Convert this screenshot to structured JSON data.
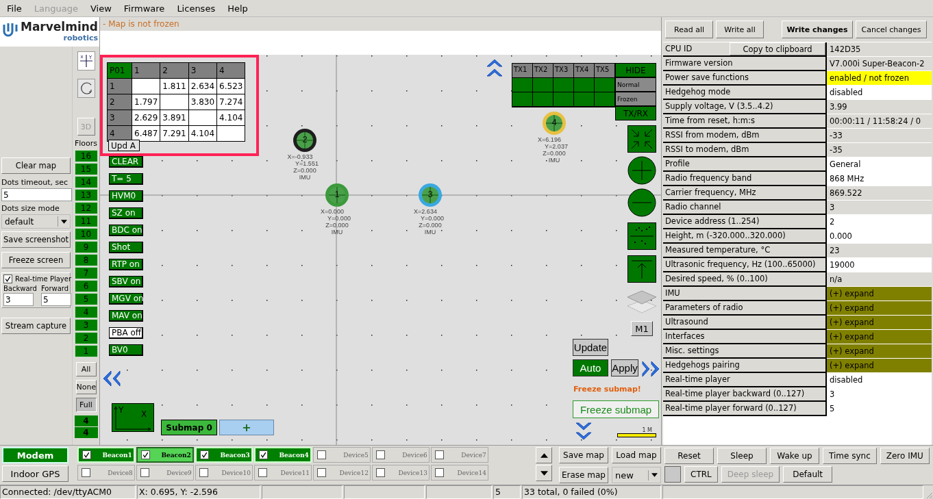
{
  "menu": [
    {
      "label": "File",
      "disabled": false
    },
    {
      "label": "Language",
      "disabled": true
    },
    {
      "label": "View",
      "disabled": false
    },
    {
      "label": "Firmware",
      "disabled": false
    },
    {
      "label": "Licenses",
      "disabled": false
    },
    {
      "label": "Help",
      "disabled": false
    }
  ],
  "logo": {
    "name": "Marvelmind",
    "tagline": "robotics"
  },
  "left_panel": {
    "clear_map": "Clear map",
    "dots_timeout": {
      "label": "Dots timeout, sec",
      "value": "5"
    },
    "dots_size": {
      "label": "Dots size mode",
      "value": "default"
    },
    "save_screenshot": "Save screenshot",
    "freeze_screen": "Freeze screen",
    "realtime_player": {
      "label": "Real-time Player",
      "checked": true
    },
    "backward": {
      "label": "Backward",
      "value": "3"
    },
    "forward": {
      "label": "Forward",
      "value": "5"
    },
    "stream_capture": "Stream capture"
  },
  "floors": {
    "view_3d": {
      "label": "3D",
      "disabled": true
    },
    "title": "Floors",
    "levels": [
      "16",
      "15",
      "14",
      "13",
      "12",
      "11",
      "10",
      "9",
      "8",
      "7",
      "6",
      "5",
      "4",
      "3",
      "2",
      "1"
    ],
    "filters": [
      {
        "label": "All",
        "selected": false
      },
      {
        "label": "None",
        "selected": false
      },
      {
        "label": "Full",
        "selected": true
      }
    ],
    "counters": [
      "4",
      "4"
    ]
  },
  "map": {
    "status": "- Map is not frozen",
    "distance_table": {
      "corner": "P01",
      "columns": [
        "1",
        "2",
        "3",
        "4"
      ],
      "rows": [
        {
          "label": "1",
          "cells": [
            null,
            "1.811",
            "2.634",
            "6.523"
          ]
        },
        {
          "label": "2",
          "cells": [
            "1.797",
            null,
            "3.830",
            "7.274"
          ]
        },
        {
          "label": "3",
          "cells": [
            "2.629",
            "3.891",
            null,
            "4.104"
          ]
        },
        {
          "label": "4",
          "cells": [
            "6.487",
            "7.291",
            "4.104",
            null
          ]
        }
      ]
    },
    "update_button": "Upd A",
    "toggles": [
      {
        "label": "CLEAR",
        "on": true
      },
      {
        "label": "T= 5",
        "on": true
      },
      {
        "label": "HVM0",
        "on": true
      },
      {
        "label": "SZ on",
        "on": true
      },
      {
        "label": "BDC on",
        "on": true
      },
      {
        "label": "Shot",
        "on": true
      },
      {
        "label": "RTP on",
        "on": true
      },
      {
        "label": "SBV on",
        "on": true
      },
      {
        "label": "MGV on",
        "on": true
      },
      {
        "label": "MAV on",
        "on": true
      },
      {
        "label": "PBA off",
        "on": false
      },
      {
        "label": "BV0",
        "on": true
      }
    ],
    "beacons": [
      {
        "number": "1",
        "color": "#3c9a3c",
        "lines": [
          "X=0.000",
          "Y=0.000",
          "Z=0.000",
          "IMU"
        ]
      },
      {
        "number": "2",
        "color": "#1e1e1e",
        "lines": [
          "X=-0.933",
          "Y=1.551",
          "Z=0.000",
          "IMU"
        ]
      },
      {
        "number": "3",
        "color": "#3aa8e0",
        "lines": [
          "X=2.634",
          "Y=0.000",
          "Z=0.000",
          "IMU"
        ]
      },
      {
        "number": "4",
        "color": "#e8c040",
        "lines": [
          "X=6.196",
          "Y=2.037",
          "Z=0.000",
          "IMU"
        ]
      }
    ],
    "tx_panel": {
      "headers": [
        "TX1",
        "TX2",
        "TX3",
        "TX4",
        "TX5"
      ],
      "buttons": [
        {
          "label": "HIDE",
          "on": true
        },
        {
          "label": "Normal",
          "on": false
        },
        {
          "label": "Frozen",
          "on": false
        },
        {
          "label": "TX/RX",
          "on": true
        }
      ]
    },
    "floor_button": "M1",
    "update": "Update",
    "auto": "Auto",
    "apply": "Apply",
    "freeze_warning": "Freeze submap!",
    "freeze_submap": "Freeze submap",
    "axes_button": {
      "y": "Y",
      "x": "X"
    },
    "submap": "Submap 0",
    "add_submap": "+",
    "scale": "1 M"
  },
  "settings": {
    "buttons": [
      {
        "label": "Read all",
        "bold": false
      },
      {
        "label": "Write all",
        "bold": false
      },
      {
        "label": "Write changes",
        "bold": true
      },
      {
        "label": "Cancel changes",
        "bold": false
      }
    ],
    "copy_button": "Copy to clipboard",
    "rows": [
      {
        "label": "CPU ID",
        "value": "142D35",
        "kind": "readonly"
      },
      {
        "label": "Firmware version",
        "value": "V7.000i Super-Beacon-2",
        "kind": "readonly"
      },
      {
        "label": "Power save functions",
        "value": "enabled / not frozen",
        "kind": "highlight"
      },
      {
        "label": "Hedgehog mode",
        "value": "disabled",
        "kind": "editable"
      },
      {
        "label": "Supply voltage, V (3.5..4.2)",
        "value": "3.99",
        "kind": "readonly"
      },
      {
        "label": "Time from reset, h:m:s",
        "value": "00:00:11 / 11:58:24 / 0",
        "kind": "readonly"
      },
      {
        "label": "RSSI from modem, dBm",
        "value": "-33",
        "kind": "readonly"
      },
      {
        "label": "RSSI to modem, dBm",
        "value": "-35",
        "kind": "readonly"
      },
      {
        "label": "Profile",
        "value": "General",
        "kind": "editable"
      },
      {
        "label": "Radio frequency band",
        "value": "868 MHz",
        "kind": "editable"
      },
      {
        "label": "Carrier frequency, MHz",
        "value": "869.522",
        "kind": "readonly"
      },
      {
        "label": "Radio channel",
        "value": "3",
        "kind": "readonly"
      },
      {
        "label": "Device address (1..254)",
        "value": "2",
        "kind": "editable"
      },
      {
        "label": "Height, m (-320.000..320.000)",
        "value": "0.000",
        "kind": "editable"
      },
      {
        "label": "Measured temperature, °C",
        "value": "23",
        "kind": "readonly"
      },
      {
        "label": "Ultrasonic frequency, Hz (100..65000)",
        "value": "19000",
        "kind": "editable"
      },
      {
        "label": "Desired speed, % (0..100)",
        "value": "n/a",
        "kind": "readonly"
      },
      {
        "label": "IMU",
        "value": "(+) expand",
        "kind": "expand"
      },
      {
        "label": "Parameters of radio",
        "value": "(+) expand",
        "kind": "expand"
      },
      {
        "label": "Ultrasound",
        "value": "(+) expand",
        "kind": "expand"
      },
      {
        "label": "Interfaces",
        "value": "(+) expand",
        "kind": "expand"
      },
      {
        "label": "Misc. settings",
        "value": "(+) expand",
        "kind": "expand"
      },
      {
        "label": "Hedgehogs pairing",
        "value": "(+) expand",
        "kind": "expand"
      },
      {
        "label": "Real-time player",
        "value": "disabled",
        "kind": "editable"
      },
      {
        "label": "Real-time player backward (0..127)",
        "value": "3",
        "kind": "editable"
      },
      {
        "label": "Real-time player forward (0..127)",
        "value": "5",
        "kind": "editable"
      }
    ],
    "actions": [
      {
        "label": "Reset",
        "disabled": false
      },
      {
        "label": "Sleep",
        "disabled": false
      },
      {
        "label": "Wake up",
        "disabled": false
      },
      {
        "label": "Time sync",
        "disabled": false
      },
      {
        "label": "Zero IMU",
        "disabled": false
      }
    ],
    "actions2": [
      {
        "label": "CTRL",
        "disabled": false
      },
      {
        "label": "Deep sleep",
        "disabled": true
      },
      {
        "label": "Default",
        "disabled": false
      }
    ]
  },
  "modes": [
    {
      "label": "Modem",
      "selected": true
    },
    {
      "label": "Indoor GPS",
      "selected": false
    }
  ],
  "devices": [
    {
      "label": "Beacon1",
      "checked": true,
      "selected": false
    },
    {
      "label": "Beacon2",
      "checked": true,
      "selected": true
    },
    {
      "label": "Beacon3",
      "checked": true,
      "selected": false
    },
    {
      "label": "Beacon4",
      "checked": true,
      "selected": false
    },
    {
      "label": "Device5",
      "checked": false,
      "selected": false
    },
    {
      "label": "Device6",
      "checked": false,
      "selected": false
    },
    {
      "label": "Device7",
      "checked": false,
      "selected": false
    },
    {
      "label": "Device8",
      "checked": false,
      "selected": false
    },
    {
      "label": "Device9",
      "checked": false,
      "selected": false
    },
    {
      "label": "Device10",
      "checked": false,
      "selected": false
    },
    {
      "label": "Device11",
      "checked": false,
      "selected": false
    },
    {
      "label": "Device12",
      "checked": false,
      "selected": false
    },
    {
      "label": "Device13",
      "checked": false,
      "selected": false
    },
    {
      "label": "Device14",
      "checked": false,
      "selected": false
    }
  ],
  "map_buttons": {
    "save": "Save map",
    "load": "Load map",
    "erase": "Erase map",
    "map_select": "new"
  },
  "status_bar": {
    "connection": "Connected: /dev/ttyACM0",
    "cursor": "X: 0.695, Y: -2.596",
    "count": "5",
    "total": "33 total, 0 failed (0%)"
  }
}
